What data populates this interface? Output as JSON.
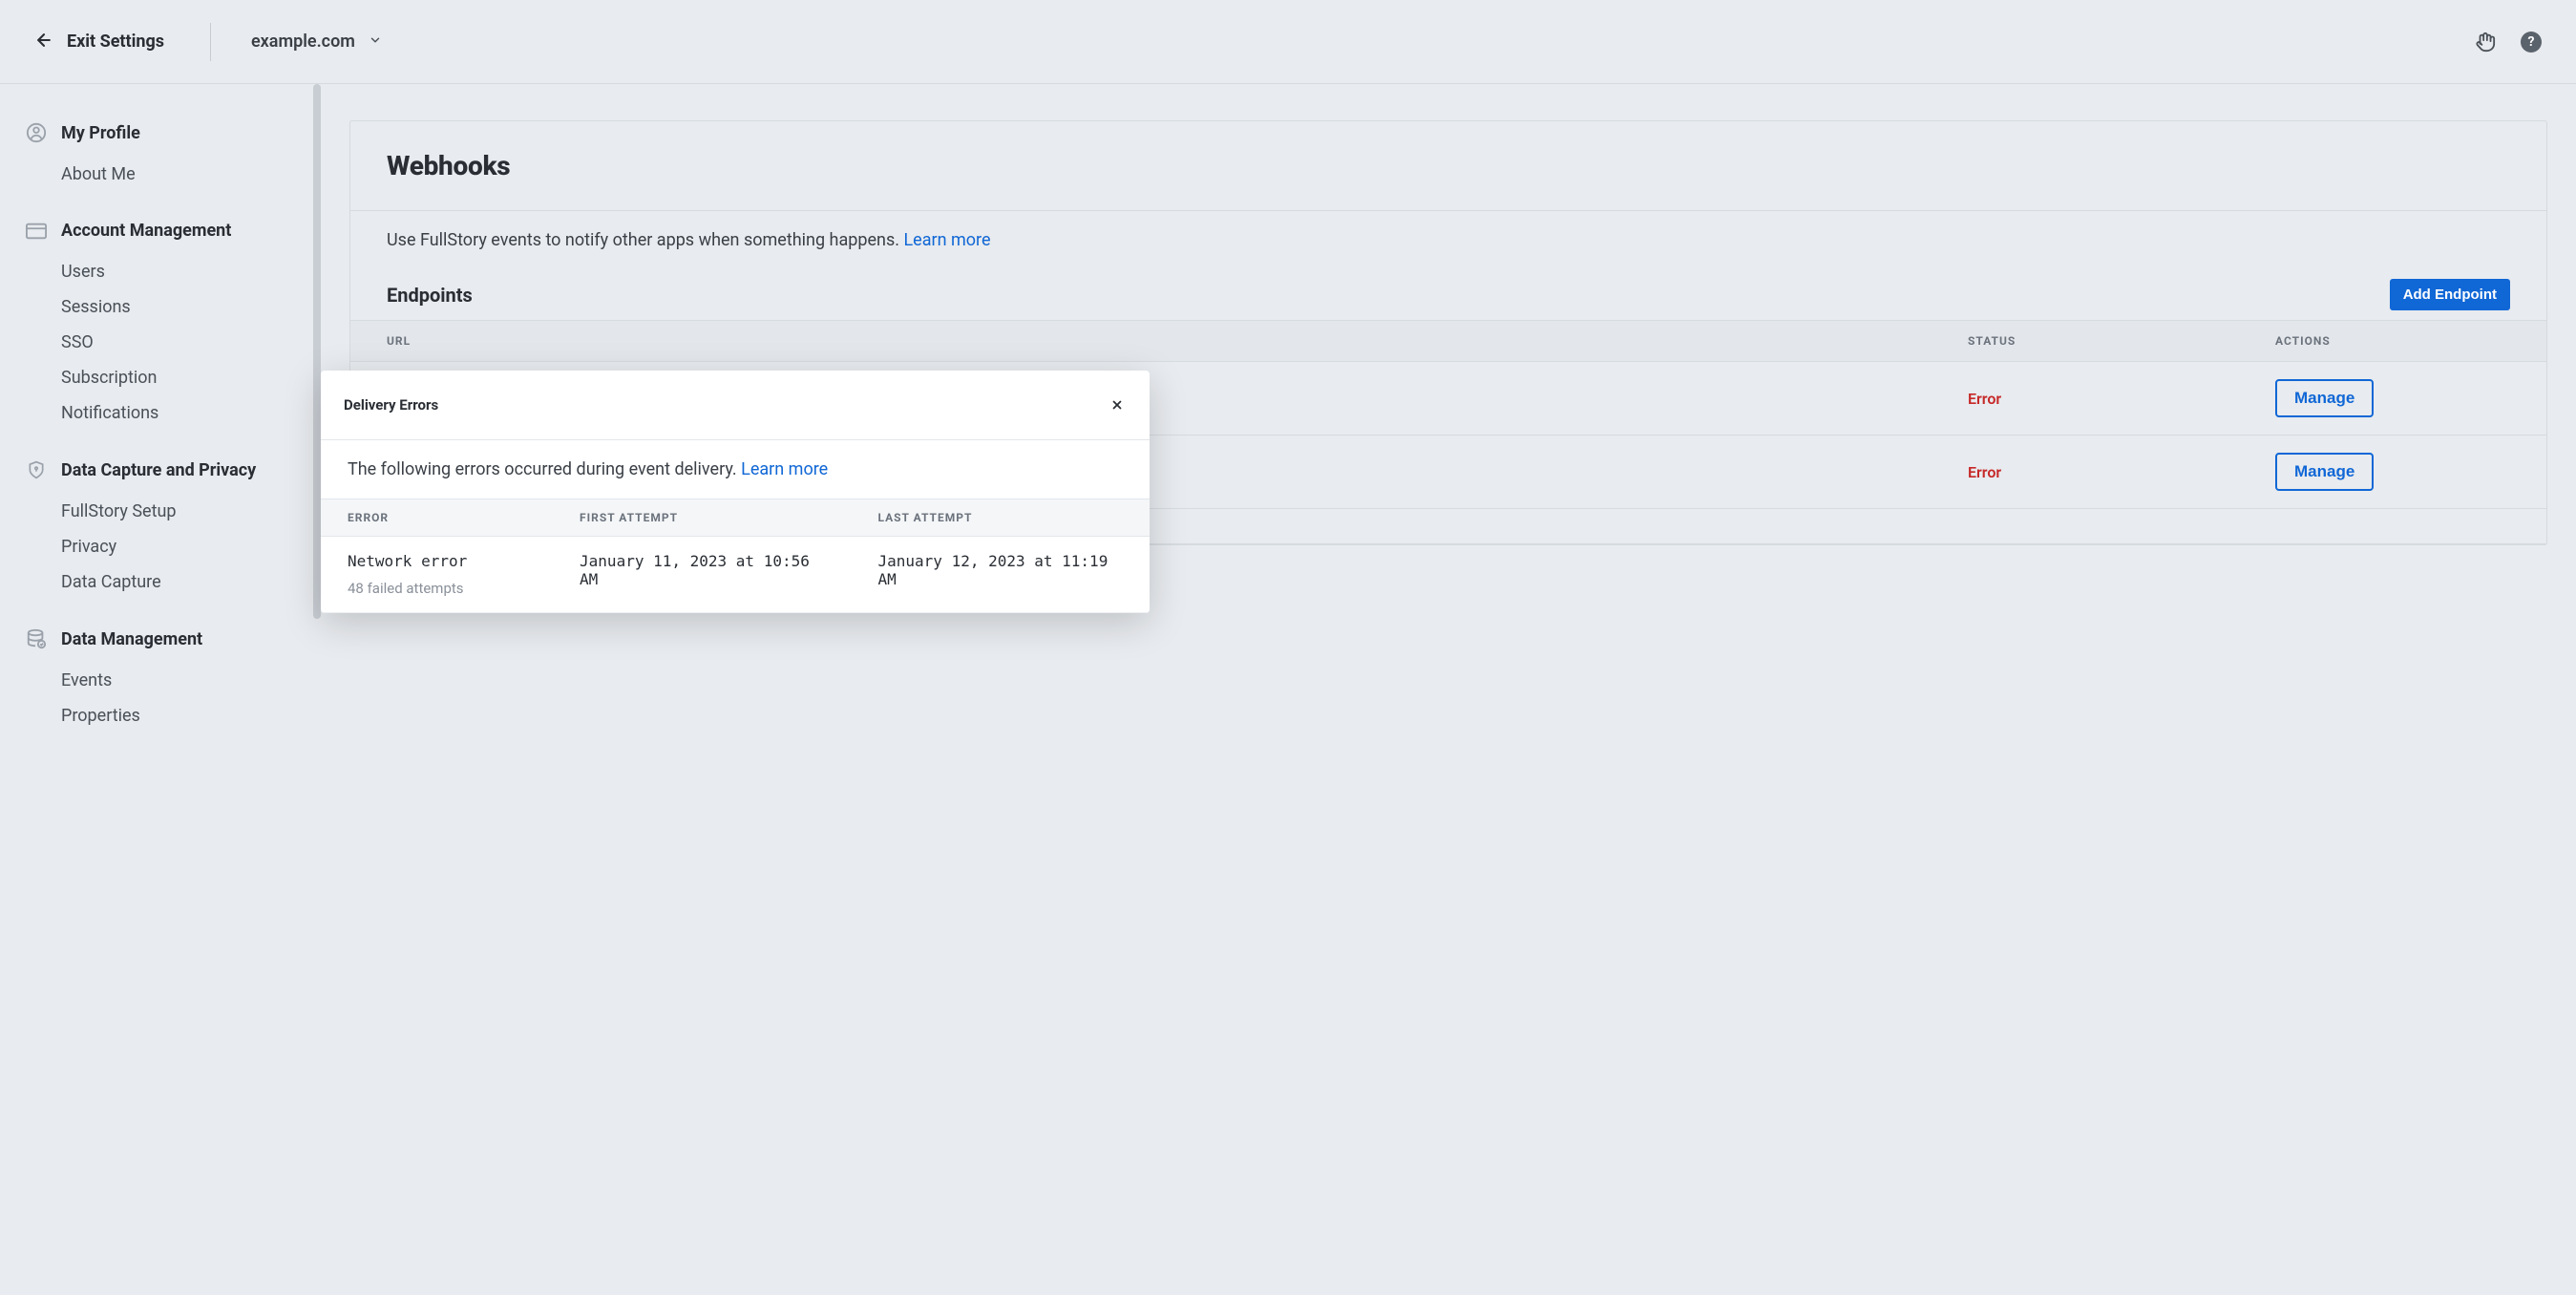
{
  "header": {
    "exit_label": "Exit Settings",
    "domain": "example.com"
  },
  "sidebar": {
    "profile_heading": "My Profile",
    "profile_items": [
      "About Me"
    ],
    "account_heading": "Account Management",
    "account_items": [
      "Users",
      "Sessions",
      "SSO",
      "Subscription",
      "Notifications"
    ],
    "capture_heading": "Data Capture and Privacy",
    "capture_items": [
      "FullStory Setup",
      "Privacy",
      "Data Capture"
    ],
    "data_mgmt_heading": "Data Management",
    "data_mgmt_items": [
      "Events",
      "Properties"
    ]
  },
  "main": {
    "title": "Webhooks",
    "description_text": "Use FullStory events to notify other apps when something happens. ",
    "learn_more_label": "Learn more",
    "endpoints_heading": "Endpoints",
    "add_endpoint_label": "Add Endpoint",
    "columns": {
      "url": "URL",
      "status": "STATUS",
      "actions": "ACTIONS"
    },
    "rows": [
      {
        "status": "Error",
        "manage_label": "Manage"
      },
      {
        "status": "Error",
        "manage_label": "Manage"
      }
    ]
  },
  "modal": {
    "title": "Delivery Errors",
    "description_text": "The following errors occurred during event delivery. ",
    "learn_more_label": "Learn more",
    "columns": {
      "error": "ERROR",
      "first": "FIRST ATTEMPT",
      "last": "LAST ATTEMPT"
    },
    "rows": [
      {
        "error_name": "Network error",
        "failed_attempts": "48 failed attempts",
        "first_attempt": "January 11, 2023 at 10:56 AM",
        "last_attempt": "January 12, 2023 at 11:19 AM"
      }
    ]
  }
}
